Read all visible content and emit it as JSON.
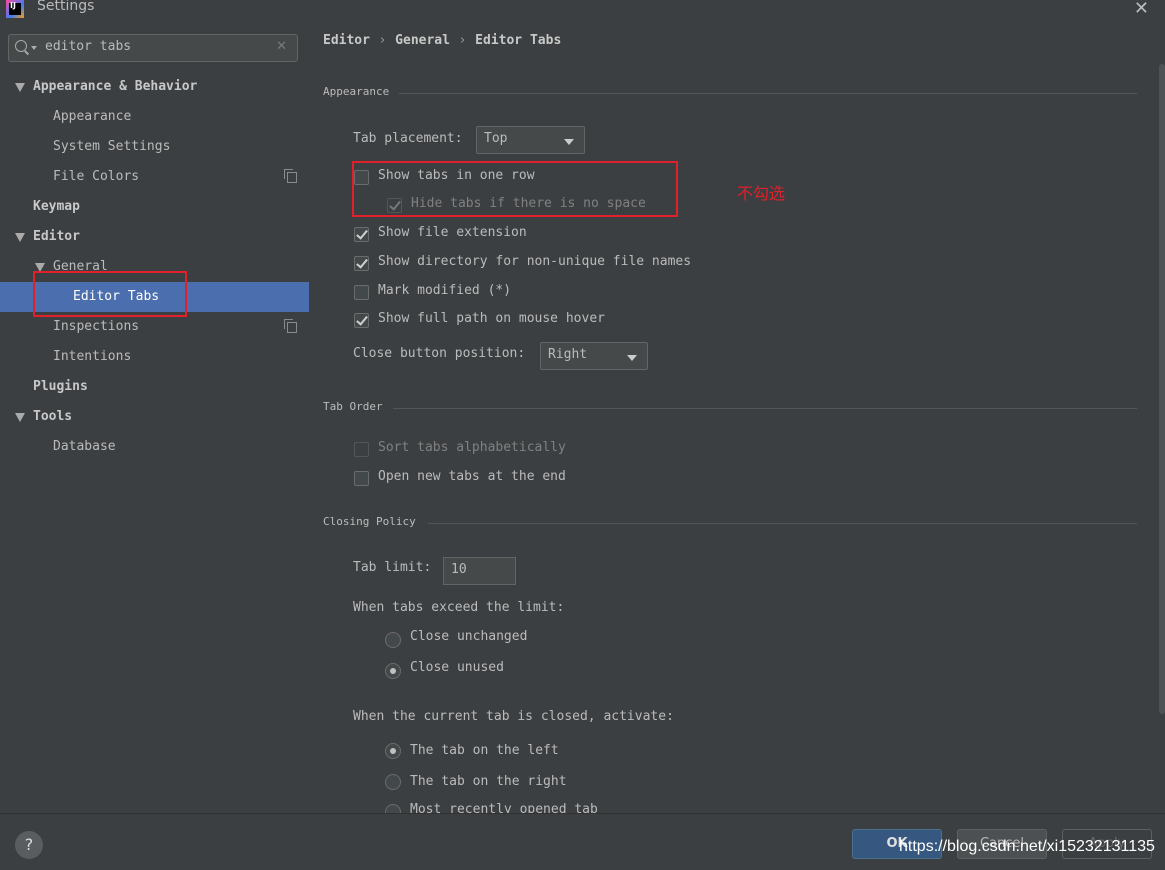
{
  "window": {
    "title": "Settings",
    "app_icon_text": "IJ"
  },
  "search": {
    "value": "editor tabs"
  },
  "tree": [
    {
      "label": "Appearance & Behavior",
      "bold": true,
      "expanded": true
    },
    {
      "label": "Appearance"
    },
    {
      "label": "System Settings"
    },
    {
      "label": "File Colors",
      "has_copy_icon": true
    },
    {
      "label": "Keymap",
      "bold": true
    },
    {
      "label": "Editor",
      "bold": true,
      "expanded": true
    },
    {
      "label": "General",
      "expanded": true
    },
    {
      "label": "Editor Tabs",
      "selected": true
    },
    {
      "label": "Inspections",
      "has_copy_icon": true
    },
    {
      "label": "Intentions"
    },
    {
      "label": "Plugins",
      "bold": true
    },
    {
      "label": "Tools",
      "bold": true,
      "expanded": true
    },
    {
      "label": "Database"
    }
  ],
  "breadcrumb": [
    "Editor",
    "General",
    "Editor Tabs"
  ],
  "breadcrumb_separator": "›",
  "appearance": {
    "section": "Appearance",
    "tab_placement_label": "Tab placement:",
    "tab_placement_value": "Top",
    "show_tabs_one_row": {
      "label": "Show tabs in one row",
      "checked": false
    },
    "hide_tabs_no_space": {
      "label": "Hide tabs if there is no space",
      "checked": true,
      "disabled": true
    },
    "show_file_extension": {
      "label": "Show file extension",
      "checked": true
    },
    "show_directory": {
      "label": "Show directory for non-unique file names",
      "checked": true
    },
    "mark_modified": {
      "label": "Mark modified (*)",
      "checked": false
    },
    "show_full_path": {
      "label": "Show full path on mouse hover",
      "checked": true
    },
    "close_button_position_label": "Close button position:",
    "close_button_position_value": "Right"
  },
  "annotation": {
    "text": "不勾选",
    "color": "#e0202a"
  },
  "tab_order": {
    "section": "Tab Order",
    "sort_alpha": {
      "label": "Sort tabs alphabetically",
      "checked": false,
      "disabled": true
    },
    "open_at_end": {
      "label": "Open new tabs at the end",
      "checked": false
    }
  },
  "closing_policy": {
    "section": "Closing Policy",
    "tab_limit_label": "Tab limit:",
    "tab_limit_value": "10",
    "exceed_label": "When tabs exceed the limit:",
    "close_unchanged": {
      "label": "Close unchanged",
      "selected": false
    },
    "close_unused": {
      "label": "Close unused",
      "selected": true
    },
    "activate_label": "When the current tab is closed, activate:",
    "tab_left": {
      "label": "The tab on the left",
      "selected": true
    },
    "tab_right": {
      "label": "The tab on the right",
      "selected": false
    },
    "most_recent": {
      "label": "Most recently opened tab",
      "selected": false
    }
  },
  "footer": {
    "help": "?",
    "ok": "OK",
    "cancel": "Cancel",
    "apply": "Apply",
    "watermark": "https://blog.csdn.net/xi15232131135"
  },
  "colors": {
    "selection": "#4b6eaf",
    "background": "#3c3f41",
    "annotation_red": "#e0202a"
  },
  "icons": [
    "search-icon",
    "clear-icon",
    "close-icon",
    "copy-icon",
    "chevron-down-icon",
    "help-icon"
  ]
}
